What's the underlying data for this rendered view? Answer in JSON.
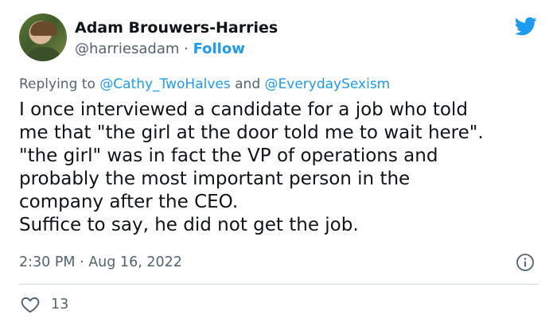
{
  "author": {
    "display_name": "Adam Brouwers-Harries",
    "handle": "@harriesadam",
    "separator": " · ",
    "follow_label": "Follow"
  },
  "reply_context": {
    "prefix": "Replying to ",
    "mention1": "@Cathy_TwoHalves",
    "conjunction": " and ",
    "mention2": "@EverydaySexism"
  },
  "body_lines": [
    "I once interviewed a candidate for a job who told",
    "me that \"the girl at the door told me to wait here\".",
    "\"the girl\" was in fact the VP of operations and",
    "probably the most important person in the",
    "company after the CEO.",
    "Suffice to say, he did not get the job."
  ],
  "timestamp": "2:30 PM · Aug 16, 2022",
  "likes": {
    "count": "13",
    "icon": "heart-icon"
  },
  "icons": {
    "brand": "twitter-bird-icon",
    "info": "info-icon"
  },
  "colors": {
    "accent": "#1d9bf0",
    "muted": "#536471",
    "text": "#0f1419",
    "divider": "#cfd9de"
  }
}
